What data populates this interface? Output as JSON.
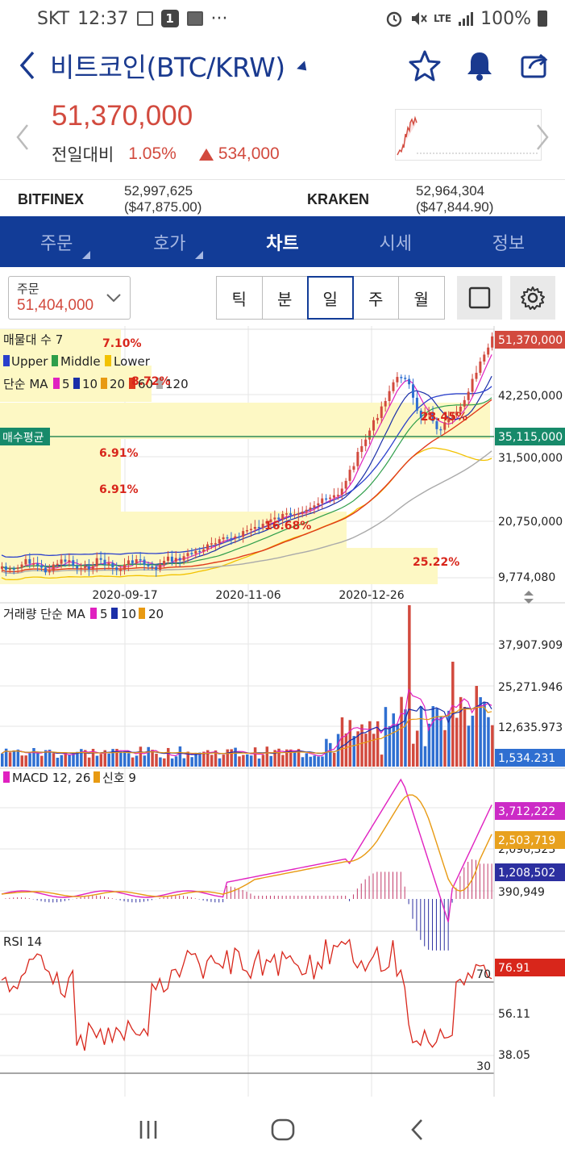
{
  "status_bar": {
    "carrier": "SKT",
    "time": "12:37",
    "badge_number": "1",
    "more": "···",
    "network": "LTE",
    "battery": "100%"
  },
  "header": {
    "title": "비트코인(BTC/KRW)",
    "icons": [
      "back-icon",
      "star-icon",
      "bell-icon",
      "share-icon"
    ]
  },
  "price": {
    "current": "51,370,000",
    "change_label": "전일대비",
    "change_pct": "1.05%",
    "change_amount": "534,000",
    "color": "#d24a3e"
  },
  "exchanges": [
    {
      "name": "BITFINEX",
      "value": "52,997,625 ($47,875.00)"
    },
    {
      "name": "KRAKEN",
      "value": "52,964,304 ($47,844.90)"
    }
  ],
  "tabs": [
    {
      "label": "주문",
      "active": false,
      "corner": true
    },
    {
      "label": "호가",
      "active": false,
      "corner": true
    },
    {
      "label": "차트",
      "active": true,
      "corner": false
    },
    {
      "label": "시세",
      "active": false,
      "corner": false
    },
    {
      "label": "정보",
      "active": false,
      "corner": false
    }
  ],
  "toolbar": {
    "order_label": "주문",
    "order_value": "51,404,000",
    "periods": [
      "틱",
      "분",
      "일",
      "주",
      "월"
    ],
    "active_period": "일"
  },
  "colors": {
    "brand": "#123c97",
    "up": "#d24a3e",
    "down": "#2f6fd1",
    "upper": "#2a3fcc",
    "middle": "#2e9e4a",
    "lower": "#f2c200",
    "ma5": "#e021c0",
    "ma10": "#1b2fa8",
    "ma20": "#e89a12",
    "ma60": "#e03a1c",
    "ma120": "#aaaaaa"
  },
  "chart_data": [
    {
      "type": "candlestick",
      "legend_lines": [
        "매물대 수 7",
        "Upper",
        "Middle",
        "Lower",
        "단순 MA",
        "5",
        "10",
        "20",
        "60",
        "120"
      ],
      "volume_profile_pcts": [
        "7.10%",
        "8.72%",
        "28.45%",
        "6.91%",
        "6.91%",
        "16.68%",
        "25.22%"
      ],
      "avg_buy_label": "매수평균",
      "avg_buy_price": "35,115,000",
      "current_price_tag": "51,370,000",
      "y_ticks": [
        "42,250,000",
        "31,500,000",
        "20,750,000",
        "9,774,080"
      ],
      "x_ticks": [
        "2020-09-17",
        "2020-11-06",
        "2020-12-26"
      ],
      "ylim": [
        9774080,
        53000000
      ]
    },
    {
      "type": "bar",
      "legend": "거래량 단순 MA",
      "legend_items": [
        "5",
        "10",
        "20"
      ],
      "y_ticks": [
        "37,907.909",
        "25,271.946",
        "12,635.973"
      ],
      "last_value": "1,534.231"
    },
    {
      "type": "line",
      "legend": "MACD 12, 26",
      "legend2": "신호 9",
      "y_ticks": [
        "2,096,323",
        "390,949"
      ],
      "tags": [
        "3,712,222",
        "2,503,719",
        "1,208,502"
      ]
    },
    {
      "type": "line",
      "legend": "RSI 14",
      "y_ticks": [
        "56.11",
        "38.05"
      ],
      "levels": [
        "70",
        "30"
      ],
      "tag_value": "76.91"
    }
  ]
}
